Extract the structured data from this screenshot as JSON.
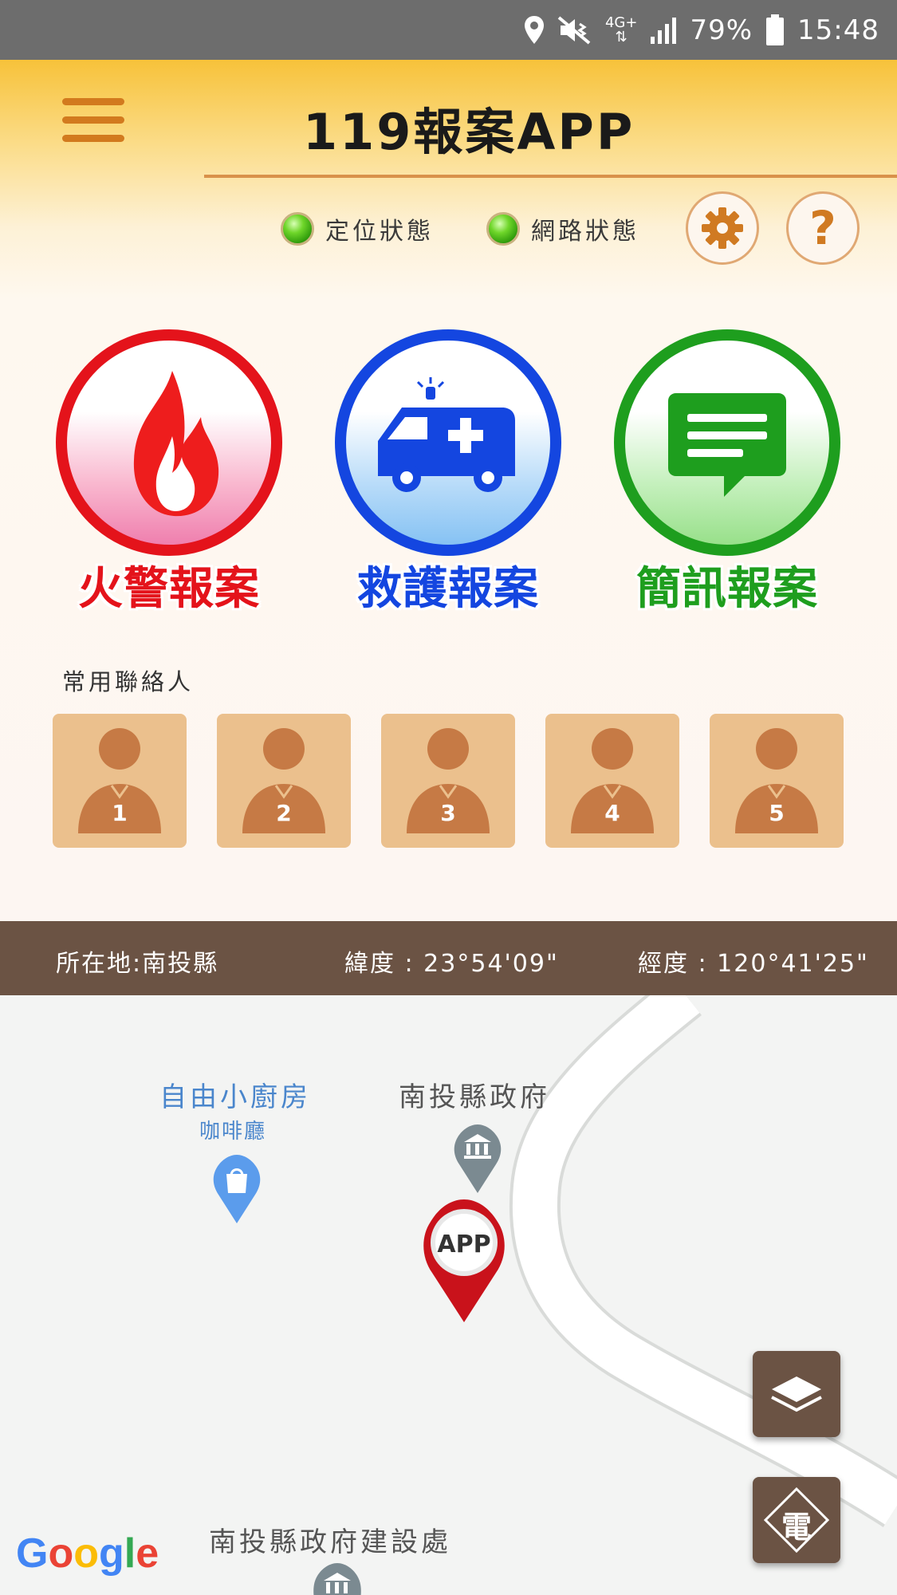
{
  "status_bar": {
    "network": "4G+",
    "battery": "79%",
    "time": "15:48"
  },
  "header": {
    "title": "119報案APP",
    "location_status_label": "定位狀態",
    "network_status_label": "網路狀態",
    "help_label": "?"
  },
  "report_buttons": [
    {
      "label": "火警報案",
      "color": "#e4131b"
    },
    {
      "label": "救護報案",
      "color": "#1446e0"
    },
    {
      "label": "簡訊報案",
      "color": "#1e9e1e"
    }
  ],
  "contacts": {
    "title": "常用聯絡人",
    "items": [
      "1",
      "2",
      "3",
      "4",
      "5"
    ]
  },
  "location_bar": {
    "location": "所在地:南投縣",
    "latitude": "緯度 : 23°54'09\"",
    "longitude": "經度 : 120°41'25\""
  },
  "map": {
    "pois": [
      {
        "name": "自由小廚房",
        "sub": "咖啡廳"
      },
      {
        "name": "南投縣政府"
      },
      {
        "name": "南投縣政府建設處"
      }
    ],
    "marker_label": "APP",
    "power_button_label": "電",
    "google_logo": {
      "G": "G",
      "o1": "o",
      "o2": "o",
      "g": "g",
      "l": "l",
      "e": "e"
    }
  }
}
